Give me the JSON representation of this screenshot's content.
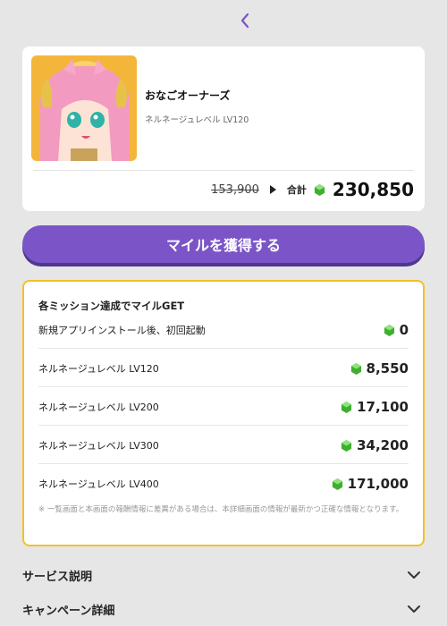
{
  "nav": {
    "back_icon": "chevron-left-icon"
  },
  "app": {
    "name": "おなごオーナーズ",
    "subtitle": "ネルネージュレベル LV120",
    "old_price": "153,900",
    "total_label": "合計",
    "total_value": "230,850"
  },
  "cta": {
    "label": "マイルを獲得する"
  },
  "missions": {
    "title": "各ミッション達成でマイルGET",
    "items": [
      {
        "label": "新規アプリインストール後、初回起動",
        "reward": "0"
      },
      {
        "label": "ネルネージュレベル LV120",
        "reward": "8,550"
      },
      {
        "label": "ネルネージュレベル LV200",
        "reward": "17,100"
      },
      {
        "label": "ネルネージュレベル LV300",
        "reward": "34,200"
      },
      {
        "label": "ネルネージュレベル LV400",
        "reward": "171,000"
      }
    ],
    "note": "※ 一覧画面と本画面の報酬情報に差異がある場合は、本詳細画面の情報が最新かつ正確な情報となります。"
  },
  "sections": [
    {
      "label": "サービス説明"
    },
    {
      "label": "キャンペーン詳細"
    }
  ],
  "colors": {
    "accent": "#7b55c8",
    "border_highlight": "#f2c02a",
    "gem": "#4cc43c"
  }
}
